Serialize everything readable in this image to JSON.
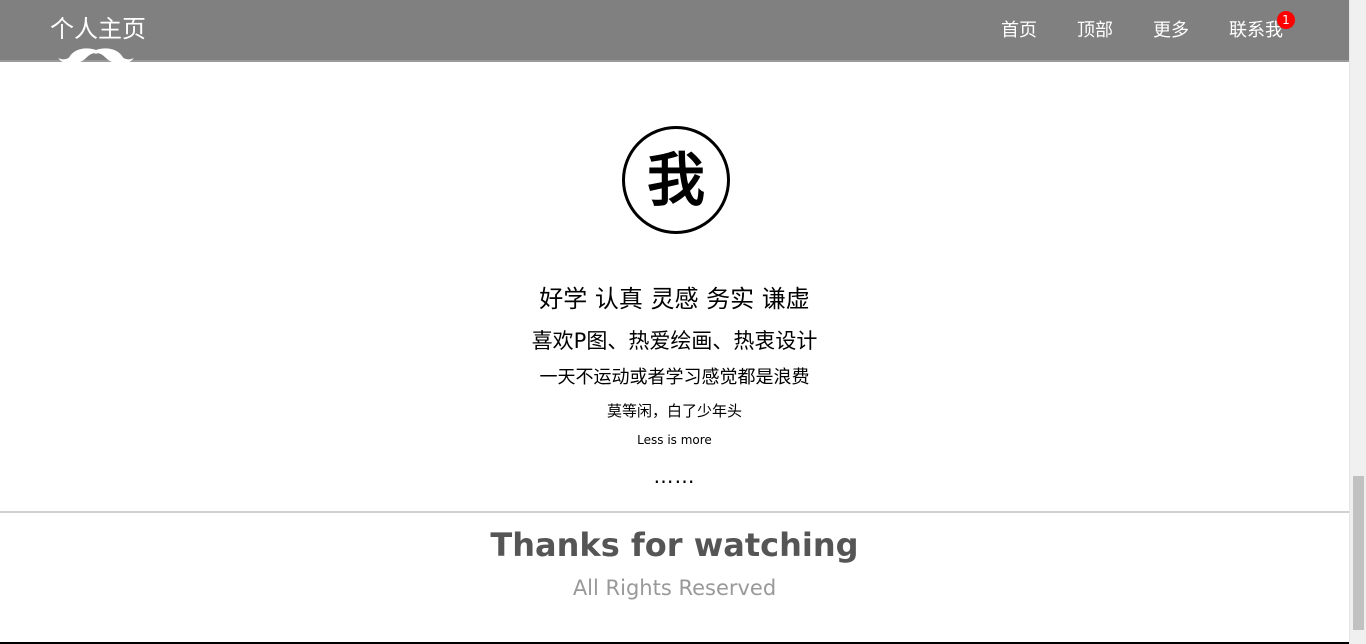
{
  "header": {
    "title": "个人主页",
    "logo_icon": "mustache-icon",
    "nav": {
      "home": "首页",
      "top": "顶部",
      "more": "更多",
      "contact": "联系我"
    },
    "contact_badge": "1"
  },
  "main": {
    "avatar_text": "我",
    "lines": [
      "好学 认真 灵感 务实 谦虚",
      "喜欢P图、热爱绘画、热衷设计",
      "一天不运动或者学习感觉都是浪费",
      "莫等闲，白了少年头",
      "Less is more",
      "……"
    ]
  },
  "footer": {
    "title": "Thanks for watching",
    "rights": "All Rights Reserved"
  },
  "colors": {
    "header_bg": "#808080",
    "badge": "#ff0000",
    "footer_title": "#555555",
    "footer_rights": "#999999"
  }
}
